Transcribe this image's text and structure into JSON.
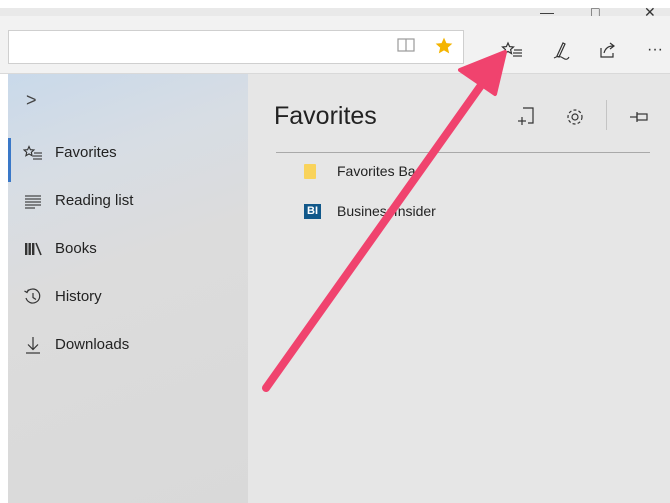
{
  "window": {
    "minimize_glyph": "—",
    "maximize_glyph": "□",
    "close_glyph": "✕"
  },
  "addressbar": {
    "url": "",
    "reading_view_icon": "reading-view-icon",
    "favorite_star_icon": "star-icon"
  },
  "toolbar": {
    "hub_icon": "favorites-hub-icon",
    "notes_icon": "pen-icon",
    "share_icon": "share-icon",
    "more_label": "···"
  },
  "sidebar": {
    "expand_glyph": ">",
    "items": [
      {
        "label": "Favorites",
        "icon": "favorites-icon",
        "glyph": "☆≡",
        "active": true
      },
      {
        "label": "Reading list",
        "icon": "reading-list-icon",
        "glyph": "≡",
        "active": false
      },
      {
        "label": "Books",
        "icon": "books-icon",
        "glyph": "⫼",
        "active": false
      },
      {
        "label": "History",
        "icon": "history-icon",
        "glyph": "↺",
        "active": false
      },
      {
        "label": "Downloads",
        "icon": "download-icon",
        "glyph": "⤓",
        "active": false
      }
    ]
  },
  "panel": {
    "title": "Favorites",
    "pin_glyph": "⊣",
    "items": [
      {
        "label": "Favorites Ba",
        "icon": "folder-icon"
      },
      {
        "label": "BusinessInsider",
        "icon": "bi-icon",
        "badge": "BI"
      }
    ]
  },
  "colors": {
    "accent": "#3a78c8",
    "star": "#f4b400",
    "arrow": "#f0436e",
    "folder": "#f9d35b",
    "bi_badge": "#11588a"
  }
}
